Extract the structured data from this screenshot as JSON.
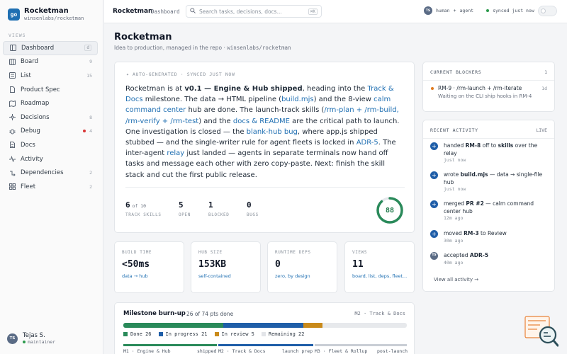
{
  "app": {
    "name": "Rocketman",
    "repo": "winsenlabs/rocketman",
    "logo_text": "go"
  },
  "sidebar": {
    "views_heading": "VIEWS",
    "items": [
      {
        "label": "Dashboard",
        "count": "d",
        "icon": "dashboard-icon"
      },
      {
        "label": "Board",
        "count": "9",
        "icon": "board-icon"
      },
      {
        "label": "List",
        "count": "15",
        "icon": "list-icon"
      },
      {
        "label": "Product Spec",
        "count": "",
        "icon": "document-icon"
      },
      {
        "label": "Roadmap",
        "count": "",
        "icon": "roadmap-icon"
      },
      {
        "label": "Decisions",
        "count": "8",
        "icon": "decisions-icon"
      },
      {
        "label": "Debug",
        "count": "4",
        "icon": "bug-icon"
      },
      {
        "label": "Docs",
        "count": "",
        "icon": "docs-icon"
      },
      {
        "label": "Activity",
        "count": "",
        "icon": "activity-icon"
      },
      {
        "label": "Dependencies",
        "count": "2",
        "icon": "dependencies-icon"
      },
      {
        "label": "Fleet",
        "count": "2",
        "icon": "fleet-icon"
      }
    ],
    "user": {
      "initials": "TS",
      "name": "Tejas S.",
      "role": "maintainer"
    }
  },
  "topbar": {
    "title": "Rocketman",
    "crumb": "Dashboard",
    "search_placeholder": "Search tasks, decisions, docs...",
    "search_shortcut": "⌘K",
    "human_initials": "TS",
    "human_label": "human",
    "plus": "+",
    "agent_label": "agent",
    "sync_status": "synced just now"
  },
  "page": {
    "title": "Rocketman",
    "subtitle_prefix": "Idea to production, managed in the repo · ",
    "subtitle_repo": "winsenlabs/rocketman"
  },
  "summary": {
    "header": "✦ AUTO-GENERATED · SYNCED JUST NOW",
    "p1": "Rocketman is at ",
    "p1_bold": "v0.1 — Engine & Hub shipped",
    "p2": ", heading into the ",
    "link_track": "Track & Docs",
    "p3": " milestone. The data → HTML pipeline (",
    "link_build": "build.mjs",
    "p4": ") and the 8-view ",
    "link_hub": "calm command center",
    "p5": " hub are done. The launch-track skills (",
    "link_skills": "/rm-plan + /rm-build, /rm-verify + /rm-test",
    "p6": ") and the ",
    "link_docs": "docs & README",
    "p7": " are the critical path to launch. One investigation is closed — the ",
    "link_bug": "blank-hub bug",
    "p8": ", where app.js shipped stubbed — and the single-writer rule for agent fleets is locked in ",
    "link_adr": "ADR-5",
    "p9": ". The inter-agent ",
    "link_relay": "relay",
    "p10": " just landed — agents in separate terminals now hand off tasks and message each other with zero copy-paste. Next: finish the skill stack and cut the first public release.",
    "stats": [
      {
        "value": "6",
        "of": "of 10",
        "label": "TRACK SKILLS"
      },
      {
        "value": "5",
        "of": "",
        "label": "OPEN"
      },
      {
        "value": "1",
        "of": "",
        "label": "BLOCKED"
      },
      {
        "value": "0",
        "of": "",
        "label": "BUGS"
      }
    ],
    "score": 88
  },
  "metrics": [
    {
      "label": "BUILD TIME",
      "value": "<50ms",
      "sub": "data → hub"
    },
    {
      "label": "HUB SIZE",
      "value": "153KB",
      "sub": "self-contained"
    },
    {
      "label": "RUNTIME DEPS",
      "value": "0",
      "sub": "zero, by design"
    },
    {
      "label": "VIEWS",
      "value": "11",
      "sub": "board, list, deps, fleet..."
    }
  ],
  "burnup": {
    "title": "Milestone burn-up",
    "points": "26 of 74 pts done",
    "milestone": "M2 · Track & Docs",
    "done": 26,
    "in_progress": 21,
    "in_review": 5,
    "total": 74,
    "legend": [
      {
        "label": "Done 26",
        "color": "#2a8a5a"
      },
      {
        "label": "In progress 21",
        "color": "#1f5ea8"
      },
      {
        "label": "In review 5",
        "color": "#c98a1a"
      },
      {
        "label": "Remaining 22",
        "color": "#e2e4e8"
      }
    ],
    "milestones": [
      {
        "name": "M1 · Engine & Hub",
        "status": "shipped"
      },
      {
        "name": "M2 · Track & Docs",
        "status": "launch prep"
      },
      {
        "name": "M3 · Fleet & Rollup",
        "status": "post-launch"
      }
    ]
  },
  "blockers": {
    "title": "CURRENT BLOCKERS",
    "count": "1",
    "item": {
      "title": "RM-9 · /rm-launch + /rm-iterate",
      "sub": "Waiting on the CLI ship hooks in RM-4",
      "time": "1d"
    }
  },
  "activity": {
    "title": "RECENT ACTIVITY",
    "live": "LIVE",
    "items": [
      {
        "pre": "handed ",
        "b1": "RM-8",
        "mid": " off to ",
        "b2": "skills",
        "post": " over the relay",
        "time": "just now",
        "avatar": false
      },
      {
        "pre": "wrote ",
        "b1": "build.mjs",
        "mid": " — data → single-file hub",
        "b2": "",
        "post": "",
        "time": "just now",
        "avatar": false
      },
      {
        "pre": "merged ",
        "b1": "PR #2",
        "mid": " — calm command center hub",
        "b2": "",
        "post": "",
        "time": "12m ago",
        "avatar": false
      },
      {
        "pre": "moved ",
        "b1": "RM-3",
        "mid": " to Review",
        "b2": "",
        "post": "",
        "time": "30m ago",
        "avatar": false
      },
      {
        "pre": "accepted ",
        "b1": "ADR-5",
        "mid": "",
        "b2": "",
        "post": "",
        "time": "40m ago",
        "avatar": true,
        "initials": "TS"
      }
    ],
    "view_all": "View all activity →"
  }
}
